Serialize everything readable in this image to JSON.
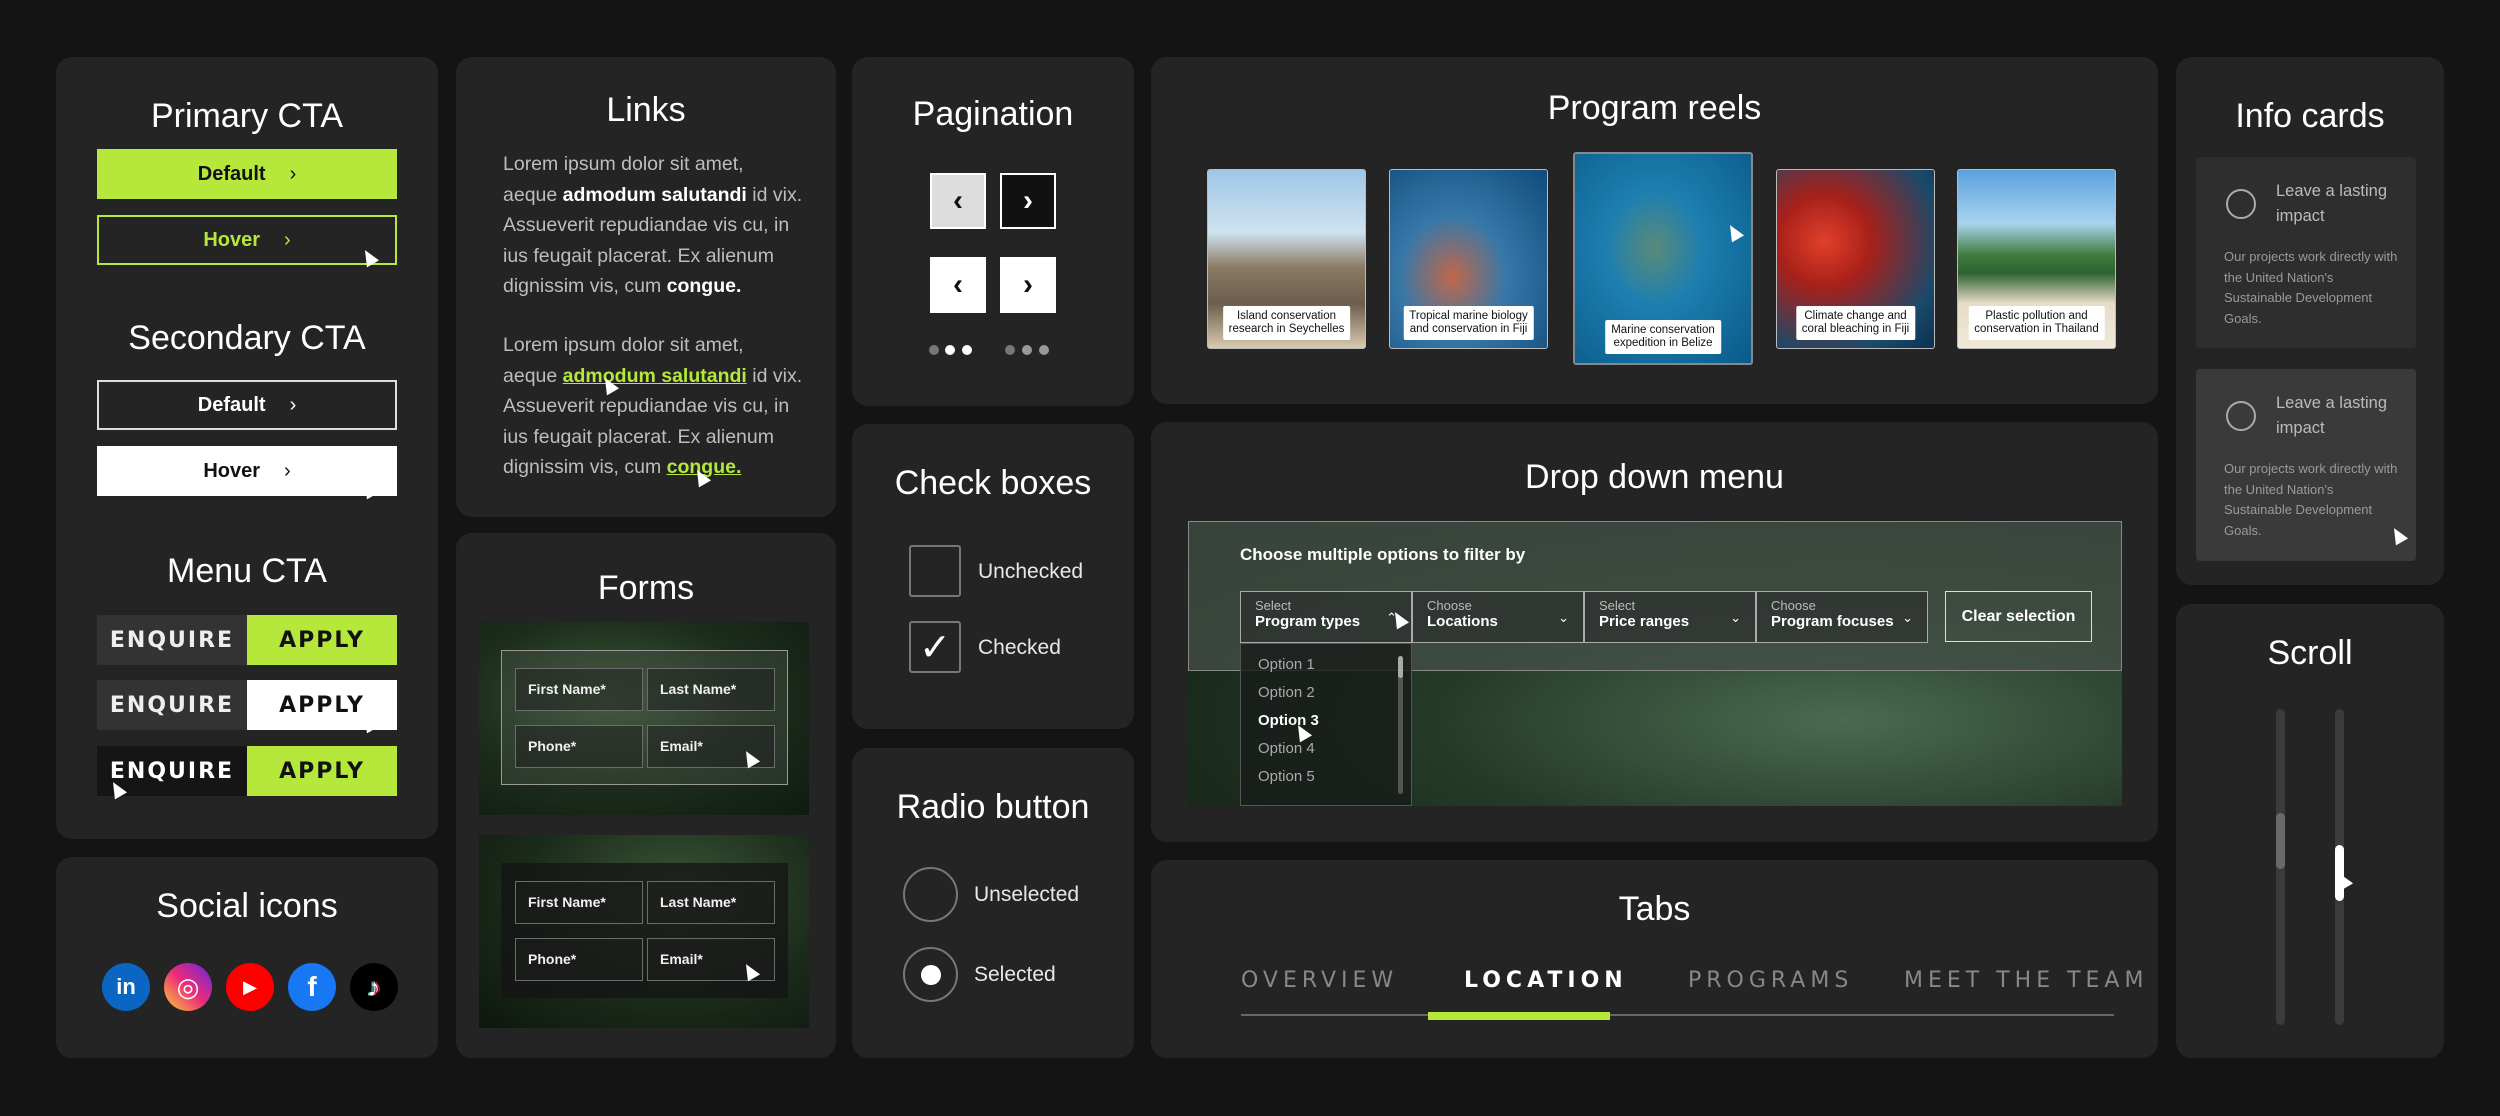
{
  "cta": {
    "primary_title": "Primary CTA",
    "primary_default": "Default",
    "primary_hover": "Hover",
    "secondary_title": "Secondary CTA",
    "secondary_default": "Default",
    "secondary_hover": "Hover",
    "menu_title": "Menu CTA",
    "enquire": "ENQUIRE",
    "apply": "APPLY",
    "chevron": "›"
  },
  "social": {
    "title": "Social icons",
    "icons": [
      {
        "name": "linkedin-icon",
        "glyph": "in",
        "color": "#0a66c2"
      },
      {
        "name": "instagram-icon",
        "glyph": "◎",
        "color": "#c13584"
      },
      {
        "name": "youtube-icon",
        "glyph": "▶",
        "color": "#ff0000"
      },
      {
        "name": "facebook-icon",
        "glyph": "f",
        "color": "#1877f2"
      },
      {
        "name": "tiktok-icon",
        "glyph": "♪",
        "color": "#000000"
      }
    ]
  },
  "links": {
    "title": "Links",
    "p1_a": "Lorem ipsum dolor sit amet, aeque ",
    "p1_b": "admodum salutandi",
    "p1_c": " id vix. Assueverit repudiandae vis cu, in ius feugait placerat. Ex alienum dignissim vis, cum ",
    "p1_d": "congue.",
    "p2_a": "Lorem ipsum dolor sit amet, aeque ",
    "p2_b": "admodum salutandi",
    "p2_c": " id vix. Assueverit repudiandae vis cu, in ius feugait placerat. Ex alienum dignissim vis, cum ",
    "p2_d": "congue."
  },
  "forms": {
    "title": "Forms",
    "first_name": "First Name*",
    "last_name": "Last Name*",
    "phone": "Phone*",
    "email": "Email*"
  },
  "pagination": {
    "title": "Pagination",
    "prev": "‹",
    "next": "›"
  },
  "checkboxes": {
    "title": "Check boxes",
    "unchecked": "Unchecked",
    "checked": "Checked",
    "check_glyph": "✓"
  },
  "radio": {
    "title": "Radio button",
    "unselected": "Unselected",
    "selected": "Selected"
  },
  "reels": {
    "title": "Program reels",
    "items": [
      {
        "caption_1": "Island conservation",
        "caption_2": "research in Seychelles"
      },
      {
        "caption_1": "Tropical marine biology",
        "caption_2": "and conservation in Fiji"
      },
      {
        "caption_1": "Marine conservation",
        "caption_2": "expedition in Belize"
      },
      {
        "caption_1": "Climate change and",
        "caption_2": "coral bleaching in Fiji"
      },
      {
        "caption_1": "Plastic pollution and",
        "caption_2": "conservation in Thailand"
      }
    ]
  },
  "dropdown": {
    "title": "Drop down menu",
    "heading": "Choose multiple options to filter by",
    "filters": [
      {
        "sub": "Select",
        "main": "Program types"
      },
      {
        "sub": "Choose",
        "main": "Locations"
      },
      {
        "sub": "Select",
        "main": "Price ranges"
      },
      {
        "sub": "Choose",
        "main": "Program focuses"
      }
    ],
    "clear": "Clear selection",
    "options": [
      "Option 1",
      "Option 2",
      "Option 3",
      "Option 4",
      "Option 5"
    ]
  },
  "tabs": {
    "title": "Tabs",
    "items": [
      "OVERVIEW",
      "LOCATION",
      "PROGRAMS",
      "MEET THE TEAM"
    ],
    "active": "LOCATION"
  },
  "info": {
    "title": "Info cards",
    "heading": "Leave a lasting impact",
    "body": "Our projects work directly with the United Nation's Sustainable Development Goals."
  },
  "scroll": {
    "title": "Scroll"
  },
  "colors": {
    "accent": "#b5e83b",
    "panel": "#242424",
    "background": "#141414"
  }
}
